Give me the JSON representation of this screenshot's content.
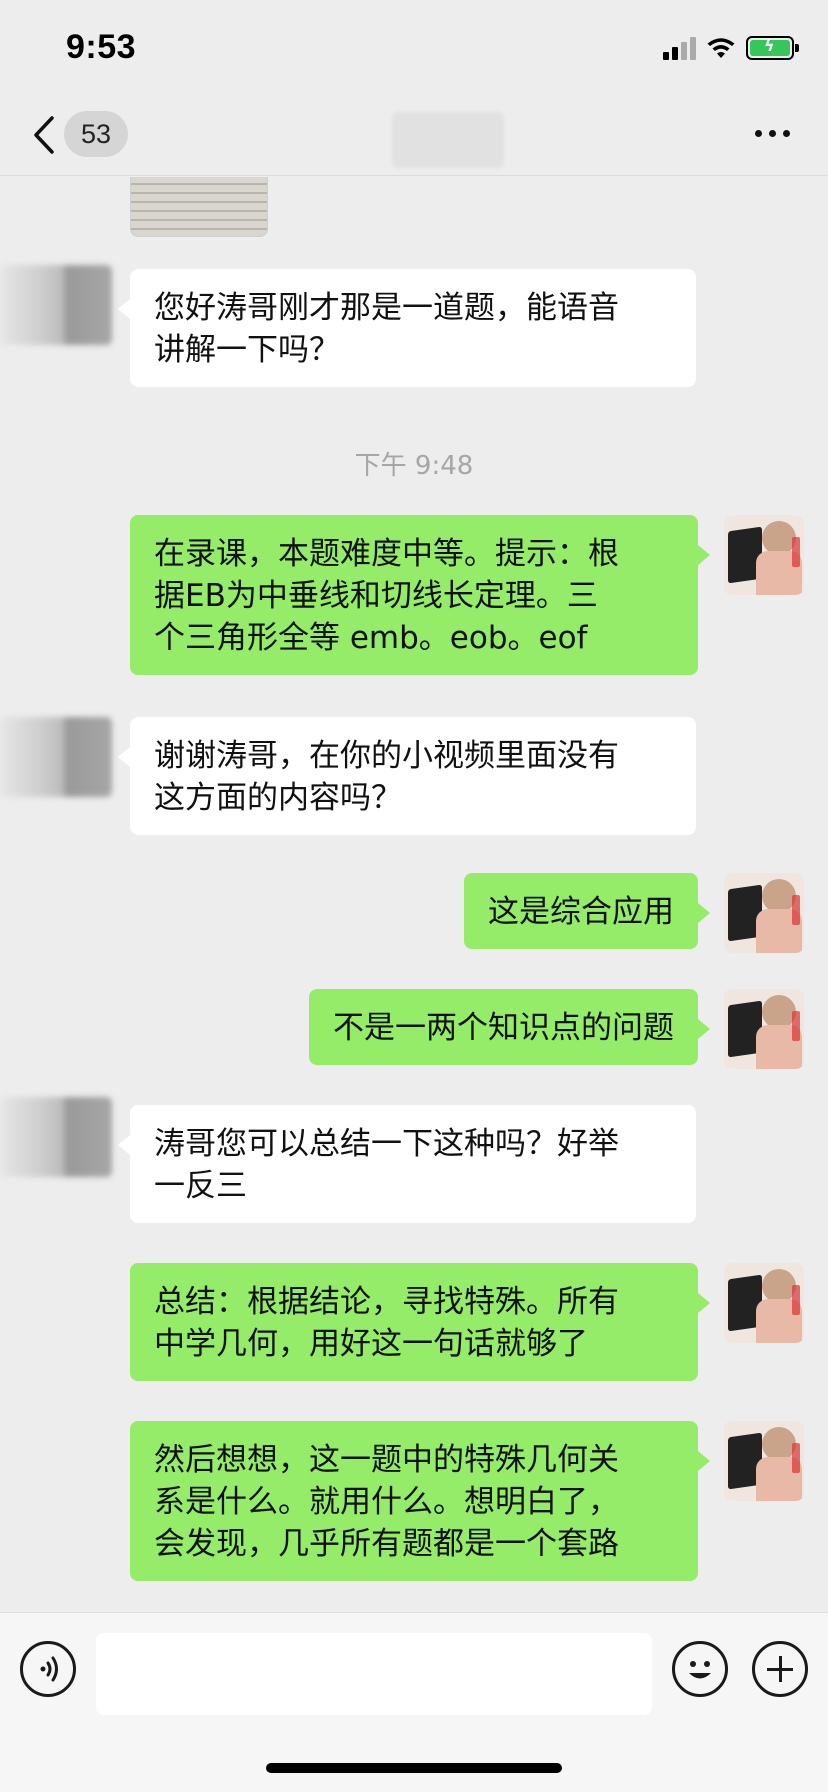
{
  "status_bar": {
    "time": "9:53",
    "icons": [
      "signal-icon",
      "wifi-icon",
      "battery-charging-icon"
    ],
    "battery_color": "#35c759"
  },
  "nav": {
    "back_icon": "chevron-left-icon",
    "unread_count": "53",
    "more_icon": "ellipsis-icon"
  },
  "colors": {
    "background": "#ededed",
    "bubble_incoming": "#ffffff",
    "bubble_outgoing": "#95ec69",
    "timestamp": "#a6a6a6"
  },
  "messages": [
    {
      "sender": "contact",
      "text": "您好涛哥刚才那是一道题，能语音\n讲解一下吗？"
    },
    {
      "sender": "me",
      "text": "在录课，本题难度中等。提示：根\n据EB为中垂线和切线长定理。三\n个三角形全等  emb。eob。eof"
    },
    {
      "sender": "contact",
      "text": "谢谢涛哥，在你的小视频里面没有\n这方面的内容吗？"
    },
    {
      "sender": "me",
      "text": "这是综合应用"
    },
    {
      "sender": "me",
      "text": "不是一两个知识点的问题"
    },
    {
      "sender": "contact",
      "text": "涛哥您可以总结一下这种吗？好举\n一反三"
    },
    {
      "sender": "me",
      "text": "总结：根据结论，寻找特殊。所有\n中学几何，用好这一句话就够了"
    },
    {
      "sender": "me",
      "text": "然后想想，这一题中的特殊几何关\n系是什么。就用什么。想明白了，\n会发现，几乎所有题都是一个套路"
    }
  ],
  "timestamp": "下午 9:48",
  "input_bar": {
    "voice_icon": "voice-icon",
    "emoji_icon": "smiley-icon",
    "plus_icon": "plus-icon",
    "input_value": ""
  }
}
